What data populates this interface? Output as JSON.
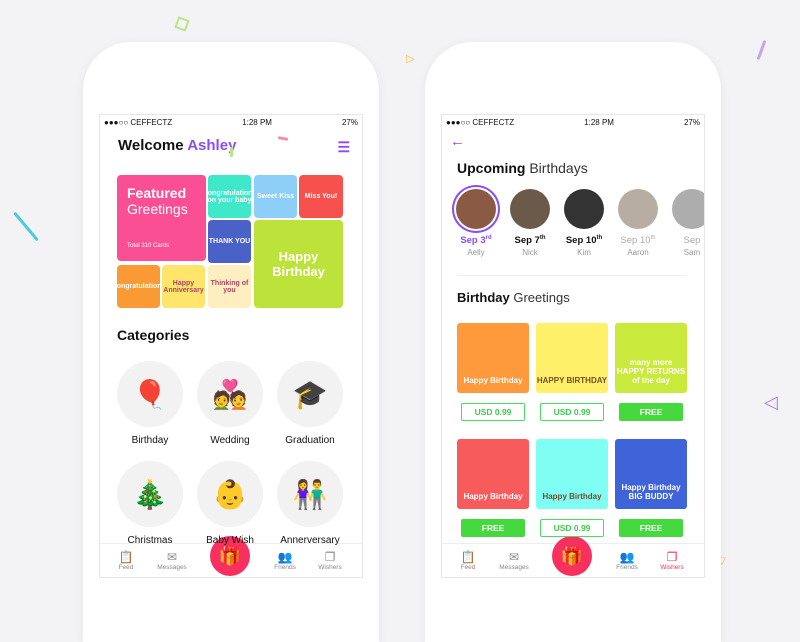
{
  "status": {
    "carrier": "●●●○○ CEFFECTZ",
    "time": "1:28 PM",
    "battery": "27%"
  },
  "home": {
    "welcome": "Welcome",
    "user": "Ashley",
    "featured": {
      "title": "Featured",
      "subtitle": "Greetings",
      "count": "Total 310 Cards"
    },
    "tiles": [
      "Congratulations on your baby",
      "Sweet Kiss",
      "Miss You!",
      "THANK YOU",
      "Happy Birthday",
      "Congratulations",
      "Happy Anniversary",
      "Thinking of you"
    ],
    "categories_title": "Categories",
    "categories": [
      {
        "label": "Birthday",
        "icon": "🎈"
      },
      {
        "label": "Wedding",
        "icon": "💑"
      },
      {
        "label": "Graduation",
        "icon": "🎓"
      },
      {
        "label": "Christmas",
        "icon": "🎄"
      },
      {
        "label": "Baby Wish",
        "icon": "👶"
      },
      {
        "label": "Annerversary",
        "icon": "👫"
      }
    ]
  },
  "tabs": [
    {
      "label": "Feed",
      "icon": "📋"
    },
    {
      "label": "Messages",
      "icon": "✉"
    },
    {
      "label": "Friends",
      "icon": "👥"
    },
    {
      "label": "Wishers",
      "icon": "❐"
    }
  ],
  "birthdays": {
    "title_bold": "Upcoming",
    "title_rest": "Birthdays",
    "people": [
      {
        "date": "Sep 3",
        "sup": "rd",
        "name": "Aelly",
        "color": "#8a5a44"
      },
      {
        "date": "Sep 7",
        "sup": "th",
        "name": "Nick",
        "color": "#6b5a4a"
      },
      {
        "date": "Sep 10",
        "sup": "th",
        "name": "Kim",
        "color": "#333"
      },
      {
        "date": "Sep 10",
        "sup": "th",
        "name": "Aaron",
        "color": "#9a8a7a"
      },
      {
        "date": "Sep",
        "sup": "",
        "name": "Sam",
        "color": "#8a8a8a"
      }
    ],
    "greet_bold": "Birthday",
    "greet_rest": "Greetings",
    "cards": [
      {
        "text": "Happy Birthday",
        "bg": "#ff9a3c",
        "price": "USD 0.99",
        "paid": true
      },
      {
        "text": "HAPPY BIRTHDAY",
        "bg": "#fff06a",
        "price": "USD 0.99",
        "paid": true
      },
      {
        "text": "many more HAPPY RETURNS of the day",
        "bg": "#c9ea3c",
        "price": "FREE",
        "paid": false
      },
      {
        "text": "Happy Birthday",
        "bg": "#f75b5b",
        "price": "FREE",
        "paid": false
      },
      {
        "text": "Happy Birthday",
        "bg": "#7ffff4",
        "price": "USD 0.99",
        "paid": true
      },
      {
        "text": "Happy Birthday BIG BUDDY",
        "bg": "#3f63d8",
        "price": "FREE",
        "paid": false
      }
    ]
  },
  "colors": {
    "accent": "#8a4df2",
    "pink": "#f8305f",
    "green": "#46d93f"
  }
}
